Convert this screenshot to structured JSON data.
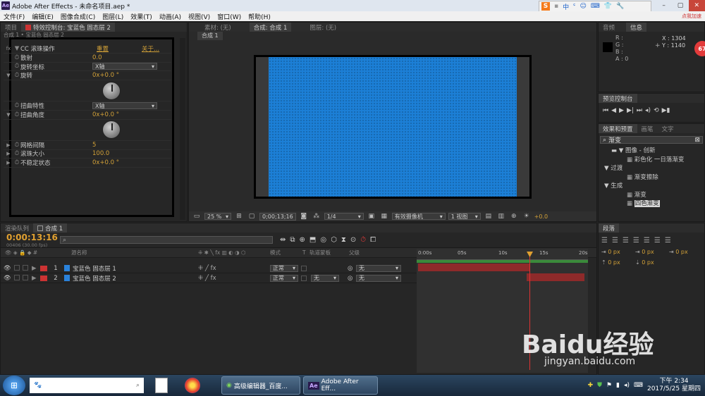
{
  "window": {
    "app_icon": "Ae",
    "title": "Adobe After Effects - 未命名项目.aep *"
  },
  "menu": [
    "文件(F)",
    "编辑(E)",
    "图像合成(C)",
    "图层(L)",
    "效果(T)",
    "动画(A)",
    "视图(V)",
    "窗口(W)",
    "帮助(H)"
  ],
  "ime": {
    "s_badge": "S",
    "items": [
      "中",
      "ᶝ",
      "☺",
      "⌨",
      "👕",
      "🔧"
    ]
  },
  "left_panel": {
    "tabs": [
      "项目",
      "特效控制台: 宝蓝色 固态层 2"
    ],
    "breadcrumb": "合成 1 • 宝蓝色 固态层 2",
    "effect": {
      "fx": "fx",
      "name": "CC 滚珠操作",
      "reset": "重置",
      "about": "关于..."
    },
    "props": [
      {
        "label": "散射",
        "value": "0.0"
      },
      {
        "label": "旋转坐标",
        "dropdown": "X轴"
      },
      {
        "label": "旋转",
        "value": "0x+0.0 °"
      },
      {
        "label": "扭曲特性",
        "dropdown": "X轴"
      },
      {
        "label": "扭曲角度",
        "value": "0x+0.0 °"
      },
      {
        "label": "网格间隔",
        "value": "5"
      },
      {
        "label": "滚珠大小",
        "value": "100.0"
      },
      {
        "label": "不稳定状态",
        "value": "0x+0.0 °"
      }
    ]
  },
  "comp_panel": {
    "tabs": [
      "素材: (无)",
      "合成: 合成 1",
      "图层: (无)"
    ],
    "subtab": "合成 1",
    "footer": {
      "zoom": "25 %",
      "time": "0;00;13;16",
      "res": "1/4",
      "camera": "有效摄像机",
      "views": "1 视图",
      "exposure": "+0.0"
    },
    "solid_color": "#1c7fd6"
  },
  "info_panel": {
    "tabs": [
      "音频",
      "信息"
    ],
    "rgba": [
      "R :",
      "G :",
      "B :",
      "A : 0"
    ],
    "x": "X : 1304",
    "y": "Y : 1140",
    "badge_top": "点我加速",
    "badge_num": "67"
  },
  "preview_panel": {
    "title": "预览控制台"
  },
  "effects_panel": {
    "tabs": [
      "效果和预置",
      "画笔",
      "文字"
    ],
    "search": "渐变",
    "tree": [
      {
        "text": "▼ 图像 - 创新",
        "indent": 1,
        "folder": true
      },
      {
        "text": "彩色化 一日落渐变",
        "indent": 2
      },
      {
        "text": "▼ 过渡",
        "indent": 0
      },
      {
        "text": "渐变擦除",
        "indent": 2
      },
      {
        "text": "▼ 生成",
        "indent": 0
      },
      {
        "text": "渐变",
        "indent": 2
      },
      {
        "text": "四色渐变",
        "indent": 2,
        "selected": true
      }
    ]
  },
  "para_panel": {
    "tab": "段落",
    "fields": [
      "0 px",
      "0 px",
      "0 px",
      "0 px",
      "0 px"
    ]
  },
  "timeline": {
    "tabs": [
      "渲染队列",
      "合成 1"
    ],
    "timecode": "0:00:13:16",
    "frames": "00406 (30.00 fps)",
    "headers": {
      "name": "源名称",
      "mode": "模式",
      "t": "T",
      "trk": "轨道蒙板",
      "parent": "父级"
    },
    "layers": [
      {
        "num": "1",
        "name": "宝蓝色 固态层 1",
        "mode": "正常",
        "trk": "",
        "parent": "无"
      },
      {
        "num": "2",
        "name": "宝蓝色 固态层 2",
        "mode": "正常",
        "trk": "无",
        "parent": "无"
      }
    ],
    "ruler": [
      "0:00s",
      "05s",
      "10s",
      "15s",
      "20s"
    ]
  },
  "taskbar": {
    "items": [
      "高级编辑器_百度...",
      "Adobe After Eff..."
    ],
    "time": "下午 2:34",
    "date": "2017/5/25 星期四"
  },
  "watermark": {
    "brand": "Baidu经验",
    "url": "jingyan.baidu.com"
  }
}
